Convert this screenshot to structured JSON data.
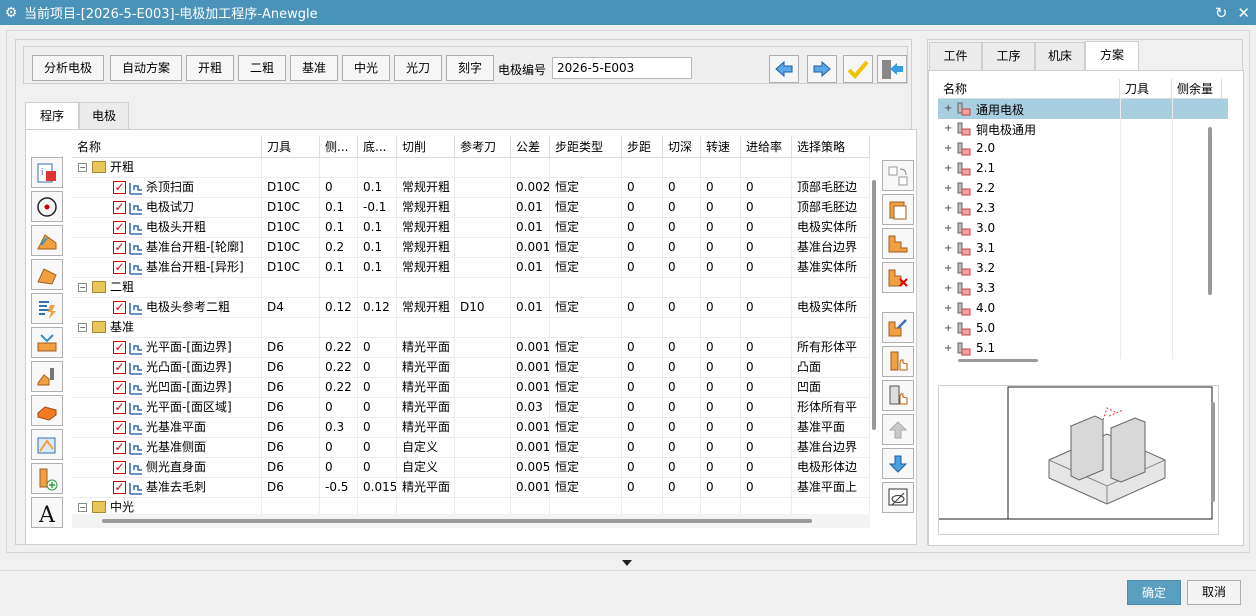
{
  "window": {
    "title": "当前项目-[2026-5-E003]-电极加工程序-Anewgle"
  },
  "toolbar": {
    "buttons": [
      "分析电极",
      "自动方案",
      "开粗",
      "二粗",
      "基准",
      "中光",
      "光刀",
      "刻字"
    ],
    "code_label": "电极编号",
    "code_value": "2026-5-E003"
  },
  "left_tabs": [
    "程序",
    "电极"
  ],
  "grid": {
    "columns": [
      "名称",
      "刀具",
      "侧...",
      "底...",
      "切削",
      "参考刀",
      "公差",
      "步距类型",
      "步距",
      "切深",
      "转速",
      "进给率",
      "选择策略"
    ],
    "groups": [
      {
        "name": "开粗",
        "rows": [
          {
            "name": "杀顶扫面",
            "tool": "D10C",
            "side": "0",
            "bottom": "0.1",
            "cut": "常规开粗",
            "ref": "",
            "tol": "0.002",
            "steptype": "恒定",
            "step": "0",
            "depth": "0",
            "speed": "0",
            "feed": "0",
            "strategy": "顶部毛胚边"
          },
          {
            "name": "电极试刀",
            "tool": "D10C",
            "side": "0.1",
            "bottom": "-0.1",
            "cut": "常规开粗",
            "ref": "",
            "tol": "0.01",
            "steptype": "恒定",
            "step": "0",
            "depth": "0",
            "speed": "0",
            "feed": "0",
            "strategy": "顶部毛胚边"
          },
          {
            "name": "电极头开粗",
            "tool": "D10C",
            "side": "0.1",
            "bottom": "0.1",
            "cut": "常规开粗",
            "ref": "",
            "tol": "0.01",
            "steptype": "恒定",
            "step": "0",
            "depth": "0",
            "speed": "0",
            "feed": "0",
            "strategy": "电极实体所"
          },
          {
            "name": "基准台开粗-[轮廓]",
            "tool": "D10C",
            "side": "0.2",
            "bottom": "0.1",
            "cut": "常规开粗",
            "ref": "",
            "tol": "0.001",
            "steptype": "恒定",
            "step": "0",
            "depth": "0",
            "speed": "0",
            "feed": "0",
            "strategy": "基准台边界"
          },
          {
            "name": "基准台开粗-[异形]",
            "tool": "D10C",
            "side": "0.1",
            "bottom": "0.1",
            "cut": "常规开粗",
            "ref": "",
            "tol": "0.01",
            "steptype": "恒定",
            "step": "0",
            "depth": "0",
            "speed": "0",
            "feed": "0",
            "strategy": "基准实体所"
          }
        ]
      },
      {
        "name": "二粗",
        "rows": [
          {
            "name": "电极头参考二粗",
            "tool": "D4",
            "side": "0.12",
            "bottom": "0.12",
            "cut": "常规开粗",
            "ref": "D10",
            "tol": "0.01",
            "steptype": "恒定",
            "step": "0",
            "depth": "0",
            "speed": "0",
            "feed": "0",
            "strategy": "电极实体所"
          }
        ]
      },
      {
        "name": "基准",
        "rows": [
          {
            "name": "光平面-[面边界]",
            "tool": "D6",
            "side": "0.22",
            "bottom": "0",
            "cut": "精光平面",
            "ref": "",
            "tol": "0.001",
            "steptype": "恒定",
            "step": "0",
            "depth": "0",
            "speed": "0",
            "feed": "0",
            "strategy": "所有形体平"
          },
          {
            "name": "光凸面-[面边界]",
            "tool": "D6",
            "side": "0.22",
            "bottom": "0",
            "cut": "精光平面",
            "ref": "",
            "tol": "0.001",
            "steptype": "恒定",
            "step": "0",
            "depth": "0",
            "speed": "0",
            "feed": "0",
            "strategy": "凸面"
          },
          {
            "name": "光凹面-[面边界]",
            "tool": "D6",
            "side": "0.22",
            "bottom": "0",
            "cut": "精光平面",
            "ref": "",
            "tol": "0.001",
            "steptype": "恒定",
            "step": "0",
            "depth": "0",
            "speed": "0",
            "feed": "0",
            "strategy": "凹面"
          },
          {
            "name": "光平面-[面区域]",
            "tool": "D6",
            "side": "0",
            "bottom": "0",
            "cut": "精光平面",
            "ref": "",
            "tol": "0.03",
            "steptype": "恒定",
            "step": "0",
            "depth": "0",
            "speed": "0",
            "feed": "0",
            "strategy": "形体所有平"
          },
          {
            "name": "光基准平面",
            "tool": "D6",
            "side": "0.3",
            "bottom": "0",
            "cut": "精光平面",
            "ref": "",
            "tol": "0.001",
            "steptype": "恒定",
            "step": "0",
            "depth": "0",
            "speed": "0",
            "feed": "0",
            "strategy": "基准平面"
          },
          {
            "name": "光基准侧面",
            "tool": "D6",
            "side": "0",
            "bottom": "0",
            "cut": "自定义",
            "ref": "",
            "tol": "0.001",
            "steptype": "恒定",
            "step": "0",
            "depth": "0",
            "speed": "0",
            "feed": "0",
            "strategy": "基准台边界"
          },
          {
            "name": "侧光直身面",
            "tool": "D6",
            "side": "0",
            "bottom": "0",
            "cut": "自定义",
            "ref": "",
            "tol": "0.005",
            "steptype": "恒定",
            "step": "0",
            "depth": "0",
            "speed": "0",
            "feed": "0",
            "strategy": "电极形体边"
          },
          {
            "name": "基准去毛刺",
            "tool": "D6",
            "side": "-0.5",
            "bottom": "0.015",
            "cut": "精光平面",
            "ref": "",
            "tol": "0.001",
            "steptype": "恒定",
            "step": "0",
            "depth": "0",
            "speed": "0",
            "feed": "0",
            "strategy": "基准平面上"
          }
        ]
      },
      {
        "name": "中光",
        "rows": []
      }
    ]
  },
  "right_tabs": [
    "工件",
    "工序",
    "机床",
    "方案"
  ],
  "scheme_tree": {
    "columns": [
      "名称",
      "刀具",
      "侧余量"
    ],
    "items": [
      "通用电极",
      "铜电极通用",
      "2.0",
      "2.1",
      "2.2",
      "2.3",
      "3.0",
      "3.1",
      "3.2",
      "3.3",
      "4.0",
      "5.0",
      "5.1"
    ]
  },
  "footer": {
    "ok": "确定",
    "cancel": "取消"
  }
}
